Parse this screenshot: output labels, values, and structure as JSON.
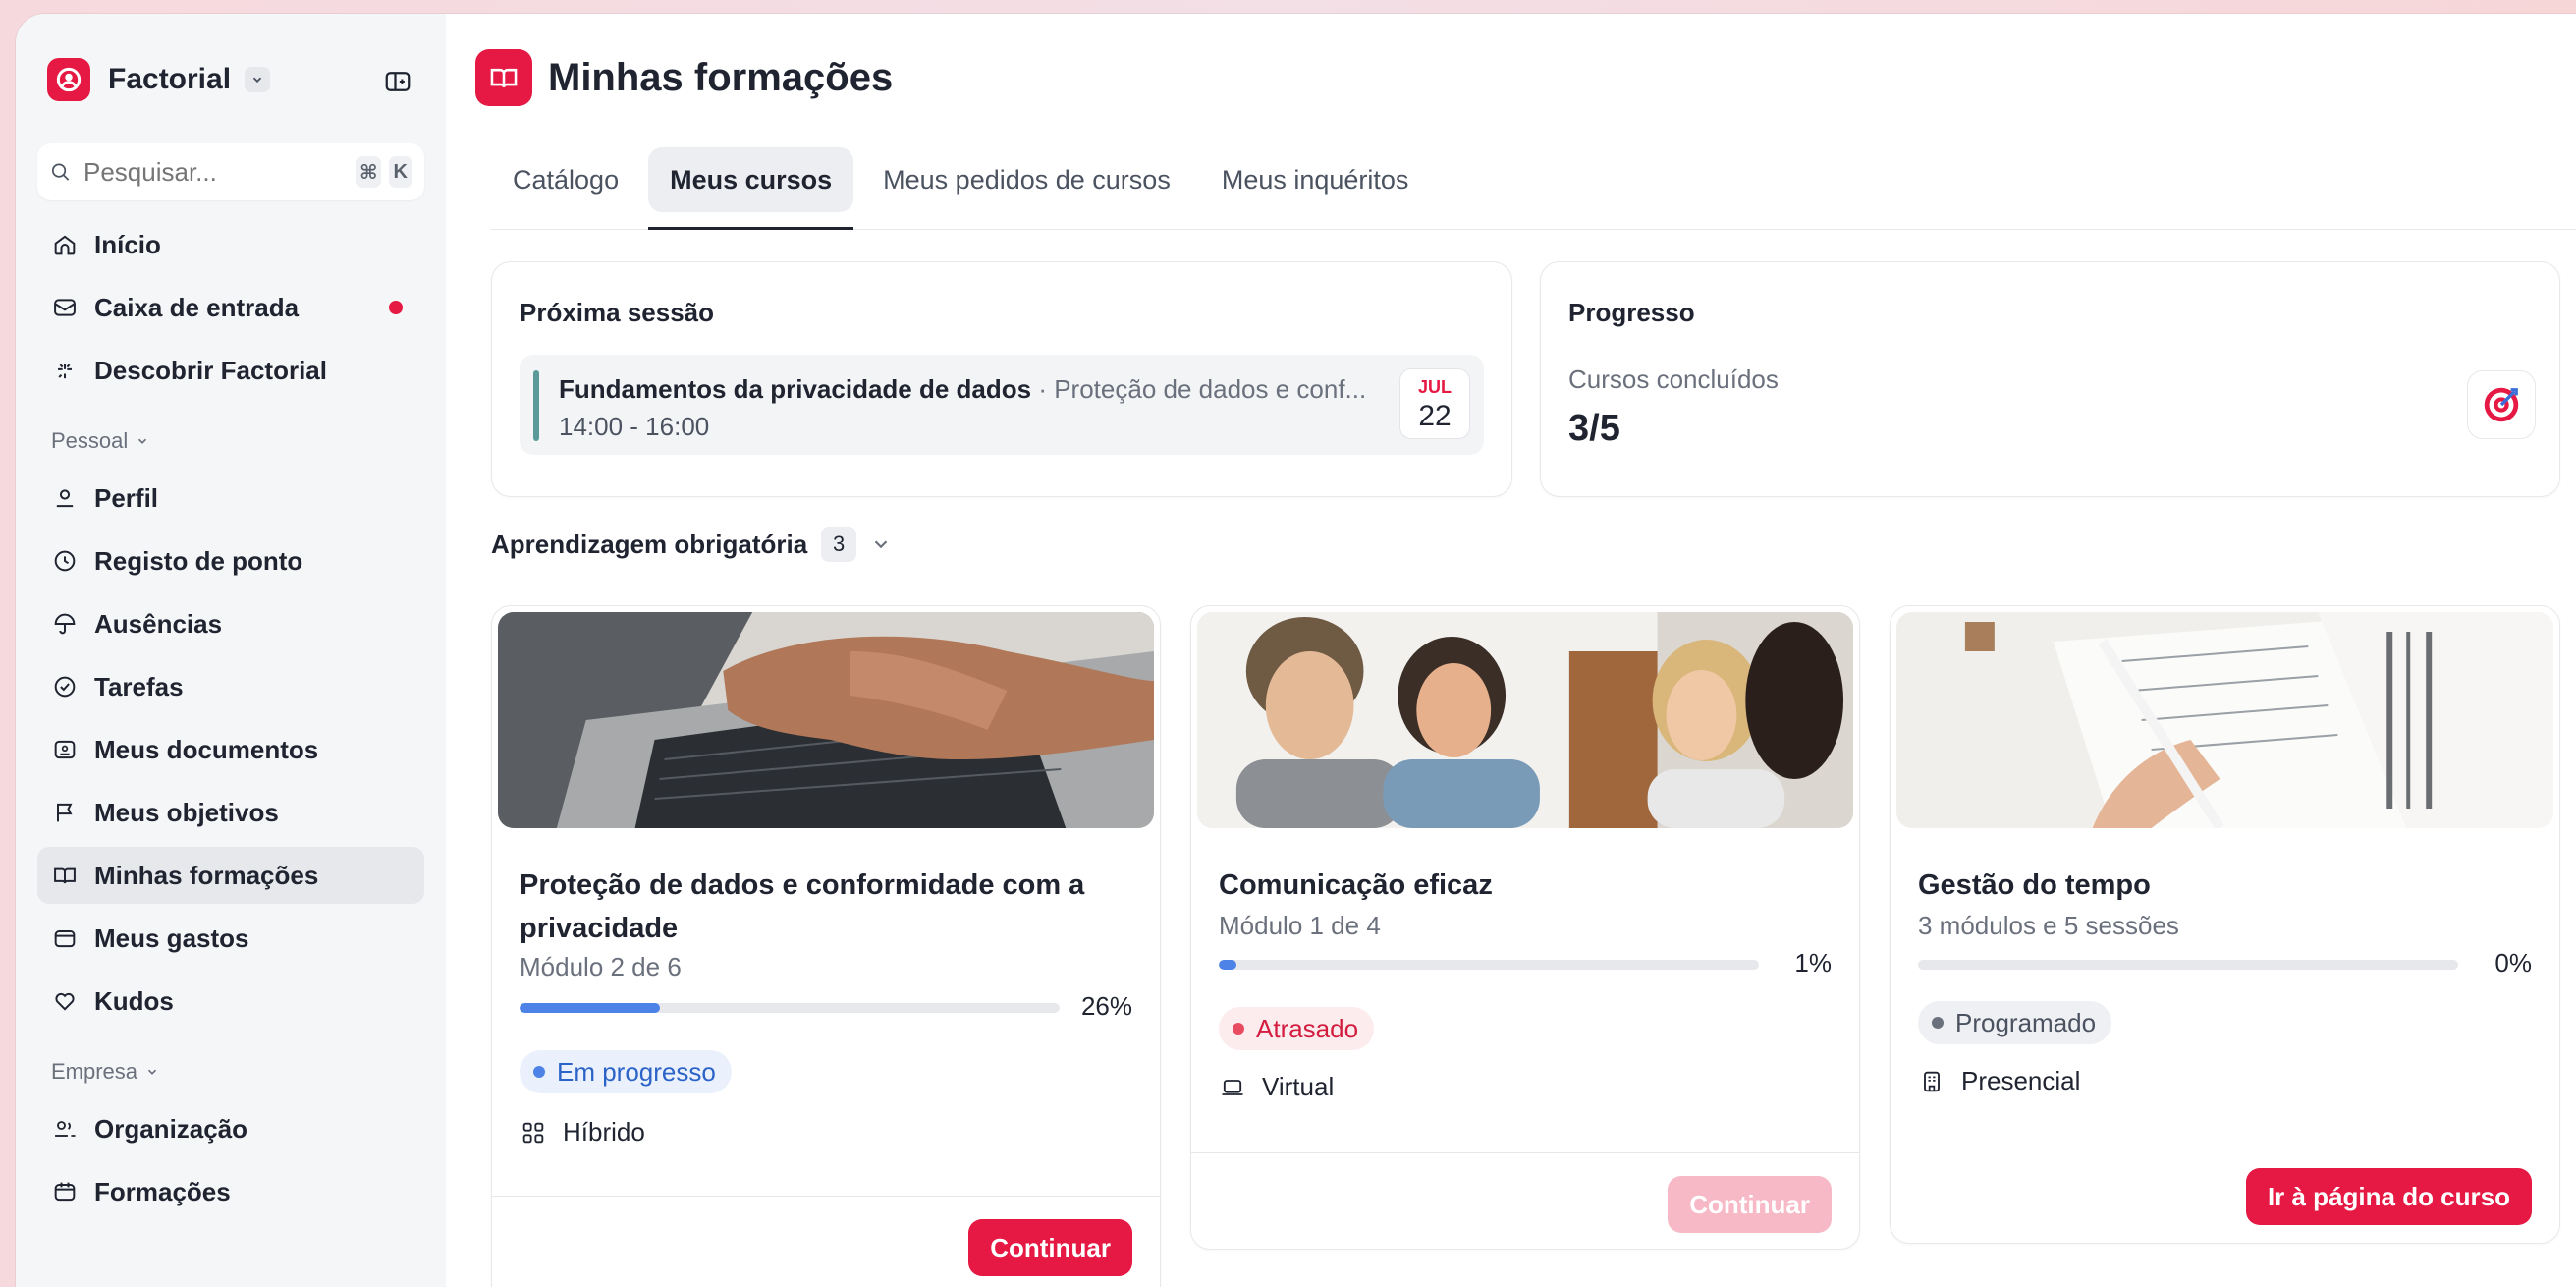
{
  "app": {
    "name": "Factorial"
  },
  "search": {
    "placeholder": "Pesquisar...",
    "shortcut_cmd": "⌘",
    "shortcut_key": "K"
  },
  "sidebar": {
    "main_items": [
      {
        "label": "Início",
        "icon": "home-icon"
      },
      {
        "label": "Caixa de entrada",
        "icon": "inbox-icon",
        "notification": true
      },
      {
        "label": "Descobrir Factorial",
        "icon": "sparkle-icon"
      }
    ],
    "personal_label": "Pessoal",
    "personal_items": [
      {
        "label": "Perfil",
        "icon": "user-icon"
      },
      {
        "label": "Registo de ponto",
        "icon": "clock-icon"
      },
      {
        "label": "Ausências",
        "icon": "umbrella-icon"
      },
      {
        "label": "Tarefas",
        "icon": "check-circle-icon"
      },
      {
        "label": "Meus documentos",
        "icon": "document-icon"
      },
      {
        "label": "Meus objetivos",
        "icon": "flag-icon"
      },
      {
        "label": "Minhas formações",
        "icon": "book-icon",
        "active": true
      },
      {
        "label": "Meus gastos",
        "icon": "wallet-icon"
      },
      {
        "label": "Kudos",
        "icon": "heart-icon"
      }
    ],
    "company_label": "Empresa",
    "company_items": [
      {
        "label": "Organização",
        "icon": "people-icon"
      },
      {
        "label": "Formações",
        "icon": "calendar-icon"
      }
    ]
  },
  "header": {
    "title": "Minhas formações"
  },
  "tabs": [
    {
      "label": "Catálogo"
    },
    {
      "label": "Meus cursos",
      "active": true
    },
    {
      "label": "Meus pedidos de cursos"
    },
    {
      "label": "Meus inquéritos"
    }
  ],
  "next_session": {
    "title": "Próxima sessão",
    "course": "Fundamentos da privacidade de dados",
    "separator": " · ",
    "subtitle": "Proteção de dados e conf...",
    "time": "14:00 - 16:00",
    "month": "JUL",
    "day": "22"
  },
  "progress": {
    "title": "Progresso",
    "label": "Cursos concluídos",
    "value": "3/5"
  },
  "mandatory": {
    "label": "Aprendizagem obrigatória",
    "count": "3"
  },
  "courses": [
    {
      "title": "Proteção de dados e conformidade com a privacidade",
      "subtitle": "Módulo 2 de 6",
      "progress": 26,
      "progress_label": "26%",
      "status": "Em progresso",
      "mode": "Híbrido",
      "button": "Continuar"
    },
    {
      "title": "Comunicação eficaz",
      "subtitle": "Módulo 1 de 4",
      "progress": 1,
      "progress_label": "1%",
      "status": "Atrasado",
      "mode": "Virtual",
      "button": "Continuar"
    },
    {
      "title": "Gestão do tempo",
      "subtitle": "3 módulos e 5 sessões",
      "progress": 0,
      "progress_label": "0%",
      "status": "Programado",
      "mode": "Presencial",
      "button": "Ir à página do curso"
    }
  ]
}
